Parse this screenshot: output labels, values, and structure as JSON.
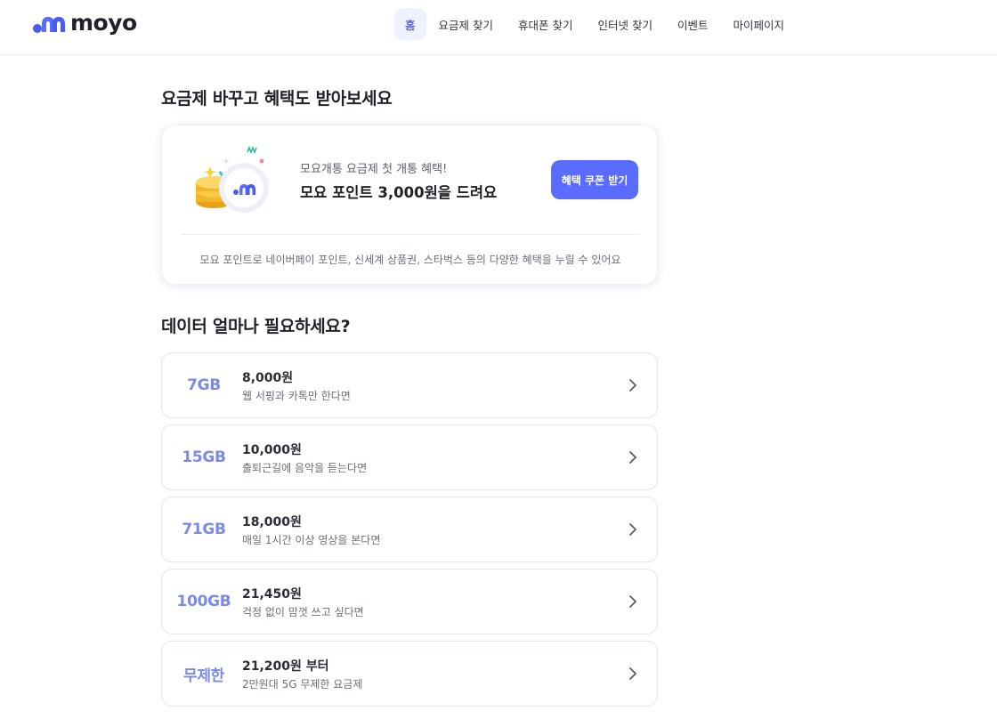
{
  "header": {
    "logo_text": "moyo",
    "nav": [
      {
        "label": "홈",
        "active": true
      },
      {
        "label": "요금제 찾기"
      },
      {
        "label": "휴대폰 찾기"
      },
      {
        "label": "인터넷 찾기"
      },
      {
        "label": "이벤트"
      },
      {
        "label": "마이페이지"
      }
    ]
  },
  "promo_section": {
    "title": "요금제 바꾸고 혜택도 받아보세요",
    "subtitle": "모요개통 요금제 첫 개통 혜택!",
    "headline": "모요 포인트 3,000원을 드려요",
    "button_label": "혜택 쿠폰 받기",
    "note": "모요 포인트로 네이버페이 포인트, 신세계 상품권, 스타벅스 등의 다양한 혜택을 누릴 수 있어요"
  },
  "data_section": {
    "title": "데이터 얼마나 필요하세요?",
    "plans": [
      {
        "data": "7GB",
        "price": "8,000원",
        "desc": "웹 서핑과 카톡만 한다면"
      },
      {
        "data": "15GB",
        "price": "10,000원",
        "desc": "출퇴근길에 음악을 듣는다면"
      },
      {
        "data": "71GB",
        "price": "18,000원",
        "desc": "매일 1시간 이상 영상을 본다면"
      },
      {
        "data": "100GB",
        "price": "21,450원",
        "desc": "걱정 없이 맘껏 쓰고 싶다면"
      },
      {
        "data": "무제한",
        "price": "21,200원 부터",
        "desc": "2만원대 5G 무제한 요금제"
      }
    ]
  },
  "colors": {
    "brand": "#5a6cff",
    "plan_data_text": "#7a8aec",
    "nav_active_bg": "#eef1fe"
  },
  "icons": {
    "logo": "moyo-logo-icon",
    "promo": "coin-point-icon",
    "chevron": "chevron-right-icon"
  }
}
